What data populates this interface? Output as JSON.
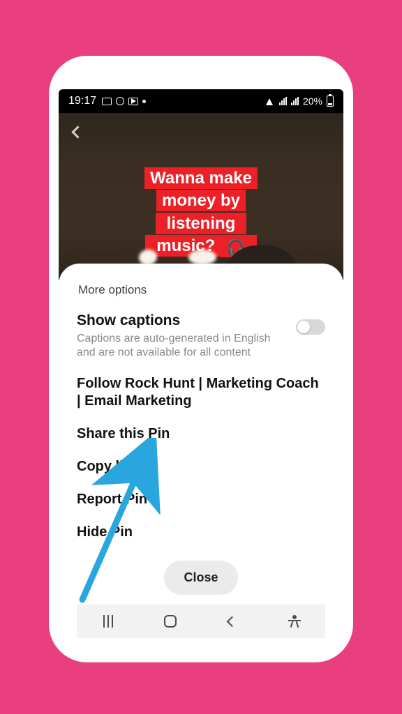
{
  "statusbar": {
    "time": "19:17",
    "battery_text": "20%"
  },
  "video": {
    "banner_line1": "Wanna make money by",
    "banner_line2": "listening music?"
  },
  "sheet": {
    "title": "More options",
    "captions": {
      "title": "Show captions",
      "subtitle": "Captions are auto-generated in English and are not available for all content"
    },
    "options": {
      "follow": "Follow Rock Hunt | Marketing Coach | Email Marketing",
      "share": "Share this Pin",
      "copy": "Copy link",
      "report": "Report Pin",
      "hide": "Hide Pin"
    },
    "close_label": "Close"
  }
}
